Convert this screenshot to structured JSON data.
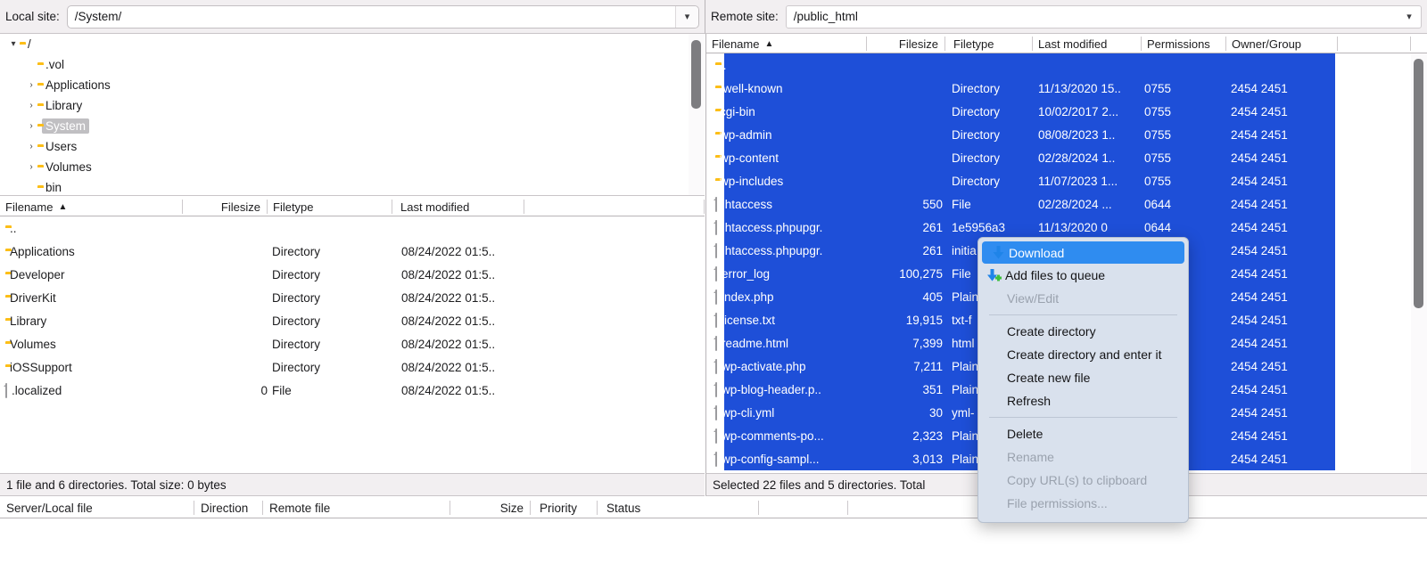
{
  "local": {
    "site_label": "Local site:",
    "site_path": "/System/",
    "tree": [
      {
        "label": "/",
        "indent": 0,
        "twisty": "down",
        "icon": "folder-icon",
        "selected": false
      },
      {
        "label": ".vol",
        "indent": 1,
        "twisty": "",
        "icon": "folder-icon",
        "selected": false
      },
      {
        "label": "Applications",
        "indent": 1,
        "twisty": "right",
        "icon": "folder-icon",
        "selected": false
      },
      {
        "label": "Library",
        "indent": 1,
        "twisty": "right",
        "icon": "folder-icon",
        "selected": false
      },
      {
        "label": "System",
        "indent": 1,
        "twisty": "right",
        "icon": "folder-open-icon",
        "selected": true
      },
      {
        "label": "Users",
        "indent": 1,
        "twisty": "right",
        "icon": "folder-icon",
        "selected": false
      },
      {
        "label": "Volumes",
        "indent": 1,
        "twisty": "right",
        "icon": "folder-icon",
        "selected": false
      },
      {
        "label": "bin",
        "indent": 1,
        "twisty": "",
        "icon": "folder-icon",
        "selected": false
      }
    ],
    "columns": [
      "Filename",
      "Filesize",
      "Filetype",
      "Last modified"
    ],
    "sort_column": "Filename",
    "sort_direction": "ascending",
    "rows": [
      {
        "name": "..",
        "size": "",
        "type": "",
        "modified": "",
        "icon": "folder-icon"
      },
      {
        "name": "Applications",
        "size": "",
        "type": "Directory",
        "modified": "08/24/2022 01:5..",
        "icon": "folder-icon"
      },
      {
        "name": "Developer",
        "size": "",
        "type": "Directory",
        "modified": "08/24/2022 01:5..",
        "icon": "folder-icon"
      },
      {
        "name": "DriverKit",
        "size": "",
        "type": "Directory",
        "modified": "08/24/2022 01:5..",
        "icon": "folder-icon"
      },
      {
        "name": "Library",
        "size": "",
        "type": "Directory",
        "modified": "08/24/2022 01:5..",
        "icon": "folder-icon"
      },
      {
        "name": "Volumes",
        "size": "",
        "type": "Directory",
        "modified": "08/24/2022 01:5..",
        "icon": "folder-icon"
      },
      {
        "name": "iOSSupport",
        "size": "",
        "type": "Directory",
        "modified": "08/24/2022 01:5..",
        "icon": "folder-icon"
      },
      {
        "name": ".localized",
        "size": "0",
        "type": "File",
        "modified": "08/24/2022 01:5..",
        "icon": "file-icon"
      }
    ],
    "status": "1 file and 6 directories. Total size: 0 bytes"
  },
  "remote": {
    "site_label": "Remote site:",
    "site_path": "/public_html",
    "columns": [
      "Filename",
      "Filesize",
      "Filetype",
      "Last modified",
      "Permissions",
      "Owner/Group"
    ],
    "sort_column": "Filename",
    "sort_direction": "ascending",
    "rows": [
      {
        "name": "..",
        "size": "",
        "type": "",
        "modified": "",
        "perm": "",
        "owner": "",
        "icon": "folder-icon",
        "selected": true
      },
      {
        "name": ".well-known",
        "size": "",
        "type": "Directory",
        "modified": "11/13/2020 15..",
        "perm": "0755",
        "owner": "2454 2451",
        "icon": "folder-icon",
        "selected": true
      },
      {
        "name": "cgi-bin",
        "size": "",
        "type": "Directory",
        "modified": "10/02/2017 2...",
        "perm": "0755",
        "owner": "2454 2451",
        "icon": "folder-icon",
        "selected": true
      },
      {
        "name": "wp-admin",
        "size": "",
        "type": "Directory",
        "modified": "08/08/2023 1..",
        "perm": "0755",
        "owner": "2454 2451",
        "icon": "folder-icon",
        "selected": true
      },
      {
        "name": "wp-content",
        "size": "",
        "type": "Directory",
        "modified": "02/28/2024 1..",
        "perm": "0755",
        "owner": "2454 2451",
        "icon": "folder-icon",
        "selected": true
      },
      {
        "name": "wp-includes",
        "size": "",
        "type": "Directory",
        "modified": "11/07/2023 1...",
        "perm": "0755",
        "owner": "2454 2451",
        "icon": "folder-icon",
        "selected": true
      },
      {
        "name": ".htaccess",
        "size": "550",
        "type": "File",
        "modified": "02/28/2024 ...",
        "perm": "0644",
        "owner": "2454 2451",
        "icon": "file-icon",
        "selected": true
      },
      {
        "name": ".htaccess.phpupgr.",
        "size": "261",
        "type": "1e5956a3",
        "modified": "11/13/2020 0",
        "perm": "0644",
        "owner": "2454 2451",
        "icon": "file-icon",
        "selected": true
      },
      {
        "name": ".htaccess.phpupgr.",
        "size": "261",
        "type": "initia",
        "modified": "",
        "perm": "",
        "owner": "2454 2451",
        "icon": "file-icon",
        "selected": true
      },
      {
        "name": "error_log",
        "size": "100,275",
        "type": "File",
        "modified": "",
        "perm": "",
        "owner": "2454 2451",
        "icon": "file-icon",
        "selected": true
      },
      {
        "name": "index.php",
        "size": "405",
        "type": "Plain",
        "modified": "",
        "perm": "",
        "owner": "2454 2451",
        "icon": "file-icon",
        "selected": true
      },
      {
        "name": "license.txt",
        "size": "19,915",
        "type": "txt-f",
        "modified": "",
        "perm": "",
        "owner": "2454 2451",
        "icon": "file-icon",
        "selected": true
      },
      {
        "name": "readme.html",
        "size": "7,399",
        "type": "html",
        "modified": "",
        "perm": "",
        "owner": "2454 2451",
        "icon": "file-icon",
        "selected": true
      },
      {
        "name": "wp-activate.php",
        "size": "7,211",
        "type": "Plain",
        "modified": "",
        "perm": "",
        "owner": "2454 2451",
        "icon": "file-icon",
        "selected": true
      },
      {
        "name": "wp-blog-header.p..",
        "size": "351",
        "type": "Plain",
        "modified": "",
        "perm": "",
        "owner": "2454 2451",
        "icon": "file-icon",
        "selected": true
      },
      {
        "name": "wp-cli.yml",
        "size": "30",
        "type": "yml-",
        "modified": "",
        "perm": "",
        "owner": "2454 2451",
        "icon": "file-icon",
        "selected": true
      },
      {
        "name": "wp-comments-po...",
        "size": "2,323",
        "type": "Plain",
        "modified": "",
        "perm": "",
        "owner": "2454 2451",
        "icon": "file-icon",
        "selected": true
      },
      {
        "name": "wp-config-sampl...",
        "size": "3,013",
        "type": "Plain",
        "modified": "",
        "perm": "",
        "owner": "2454 2451",
        "icon": "file-icon",
        "selected": true
      }
    ],
    "status": "Selected 22 files and 5 directories. Total"
  },
  "context_menu": {
    "items": [
      {
        "label": "Download",
        "icon": "download-arrow-icon",
        "state": "highlight"
      },
      {
        "label": "Add files to queue",
        "icon": "add-to-queue-icon",
        "state": "normal"
      },
      {
        "label": "View/Edit",
        "icon": "",
        "state": "disabled"
      },
      {
        "label": "---",
        "icon": "",
        "state": "separator"
      },
      {
        "label": "Create directory",
        "icon": "",
        "state": "normal"
      },
      {
        "label": "Create directory and enter it",
        "icon": "",
        "state": "normal"
      },
      {
        "label": "Create new file",
        "icon": "",
        "state": "normal"
      },
      {
        "label": "Refresh",
        "icon": "",
        "state": "normal"
      },
      {
        "label": "---",
        "icon": "",
        "state": "separator"
      },
      {
        "label": "Delete",
        "icon": "",
        "state": "normal"
      },
      {
        "label": "Rename",
        "icon": "",
        "state": "disabled"
      },
      {
        "label": "Copy URL(s) to clipboard",
        "icon": "",
        "state": "disabled"
      },
      {
        "label": "File permissions...",
        "icon": "",
        "state": "disabled"
      }
    ]
  },
  "queue": {
    "columns": [
      "Server/Local file",
      "Direction",
      "Remote file",
      "Size",
      "Priority",
      "Status"
    ]
  },
  "colors": {
    "selection_blue": "#1e4fd8",
    "menu_highlight": "#2f8cf0",
    "menu_background": "#d9e1ed",
    "folder_yellow": "#fcbe18",
    "chrome_gray": "#f2eff1"
  }
}
